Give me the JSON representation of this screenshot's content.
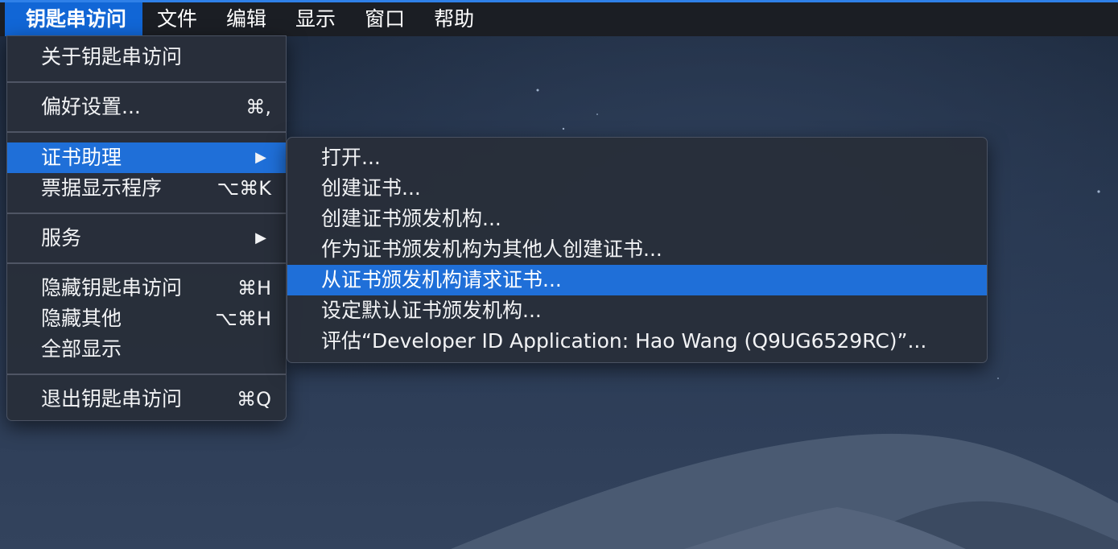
{
  "menubar": {
    "app_name": "钥匙串访问",
    "items": [
      "文件",
      "编辑",
      "显示",
      "窗口",
      "帮助"
    ]
  },
  "app_menu": {
    "about": "关于钥匙串访问",
    "preferences": "偏好设置...",
    "preferences_shortcut": "⌘,",
    "cert_assistant": "证书助理",
    "ticket_viewer": "票据显示程序",
    "ticket_viewer_shortcut": "⌥⌘K",
    "services": "服务",
    "hide_app": "隐藏钥匙串访问",
    "hide_app_shortcut": "⌘H",
    "hide_others": "隐藏其他",
    "hide_others_shortcut": "⌥⌘H",
    "show_all": "全部显示",
    "quit": "退出钥匙串访问",
    "quit_shortcut": "⌘Q",
    "submenu_arrow": "▶"
  },
  "cert_submenu": {
    "items": [
      "打开...",
      "创建证书...",
      "创建证书颁发机构...",
      "作为证书颁发机构为其他人创建证书...",
      "从证书颁发机构请求证书...",
      "设定默认证书颁发机构...",
      "评估“Developer ID Application: Hao Wang (Q9UG6529RC)”..."
    ],
    "highlighted_index": 4
  },
  "colors": {
    "highlight": "#1f6fd8",
    "menubar": "#1b1e24",
    "menu_bg": "#282e3a"
  }
}
